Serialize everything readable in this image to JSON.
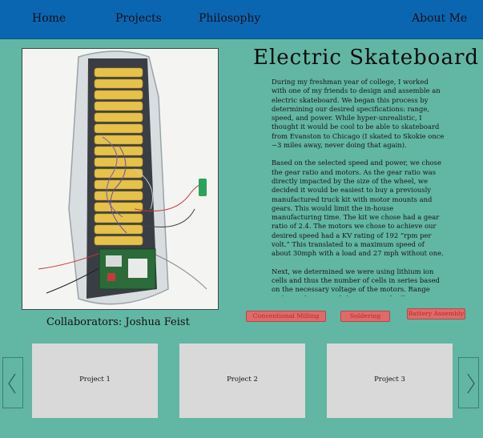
{
  "nav": {
    "home": "Home",
    "projects": "Projects",
    "philosophy": "Philosophy",
    "about": "About Me"
  },
  "project": {
    "title": "Electric Skateboard",
    "collaborators": "Collaborators: Joshua Feist",
    "paragraphs": [
      "During my freshman year of college, I worked with one of my friends to design and assemble an electric skateboard. We began this process by determining our desired specifications: range, speed, and power. While hyper-unrealistic, I thought it would be cool to be able to skateboard from Evanston to Chicago (I skated to Skokie once ~3 miles away, never doing that again).",
      "Based on the selected speed and power, we chose the gear ratio and motors. As the gear ratio was directly impacted by the size of the wheel, we decided it would be easiest to buy a previously manufactured truck kit with motor mounts and gears. This would limit the in-house manufacturing time. The kit we chose had a gear ratio of 2.4. The motors we chose to achieve our desired speed had a KV rating of 192 “rpm per volt.” This translated to a maximum speed of about 30mph with a load and 27 mph without one.",
      "Next, we determined we were using lithium ion cells and thus the number of cells in series based on the necessary voltage of the motors. Range and cost determined the amount of cells we put in parallel."
    ],
    "tags": [
      "Conventional Milling",
      "Soldering",
      "Battery Assembly"
    ]
  },
  "carousel": {
    "cards": [
      "Project 1",
      "Project 2",
      "Project 3"
    ]
  },
  "colors": {
    "background": "#62b6a4",
    "navbar": "#0a66b0",
    "tag": "#e06a6a",
    "card": "#d9d9d9"
  }
}
